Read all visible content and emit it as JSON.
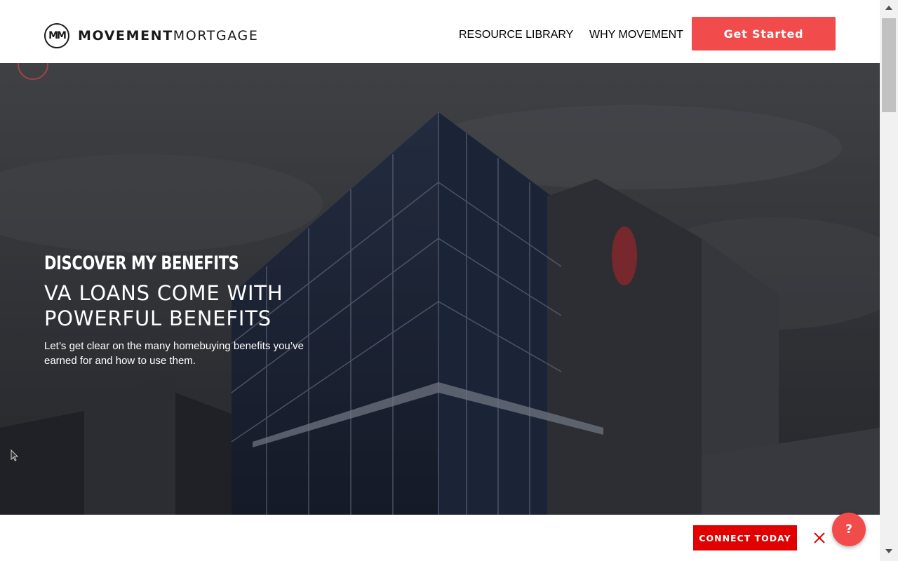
{
  "header": {
    "logo_mark": "MM",
    "logo_bold": "MOVEMENT",
    "logo_light": "MORTGAGE",
    "nav": [
      {
        "label": "RESOURCE LIBRARY"
      },
      {
        "label": "WHY MOVEMENT"
      }
    ],
    "cta_label": "Get Started"
  },
  "hero": {
    "eyebrow": "DISCOVER MY BENEFITS",
    "title": "VA LOANS COME WITH POWERFUL BENEFITS",
    "subtitle": "Let’s get clear on the many homebuying benefits you’ve earned for and how to use them."
  },
  "bottom_bar": {
    "connect_label": "CONNECT TODAY",
    "help_label": "?"
  },
  "colors": {
    "brand_red": "#f24b4b",
    "connect_red": "#e00000",
    "text_dark": "#1a1a1a"
  },
  "icons": [
    "logo-icon",
    "close-icon",
    "help-icon",
    "scroll-up-arrow-icon",
    "scroll-down-arrow-icon",
    "cursor-icon"
  ]
}
